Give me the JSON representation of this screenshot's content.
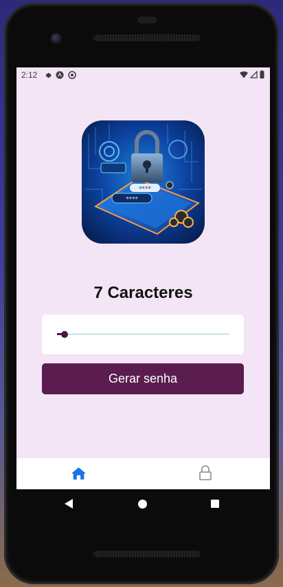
{
  "status_bar": {
    "time": "2:12",
    "left_icons": [
      "gear-icon",
      "app-a-icon",
      "sync-icon"
    ],
    "right_icons": [
      "wifi-icon",
      "signal-icon",
      "battery-icon"
    ]
  },
  "main": {
    "title": "7 Caracteres",
    "slider": {
      "value": 7,
      "fraction": 0.02
    },
    "generate_button_label": "Gerar senha"
  },
  "tabs": [
    {
      "icon": "home-icon",
      "active": true,
      "color": "#1a73e8"
    },
    {
      "icon": "lock-icon",
      "active": false,
      "color": "#8a8a8a"
    }
  ],
  "colors": {
    "screen_bg": "#f3e5f5",
    "primary": "#5a1d4e",
    "slider_track": "#9fc6d6",
    "tab_active": "#1a73e8"
  }
}
